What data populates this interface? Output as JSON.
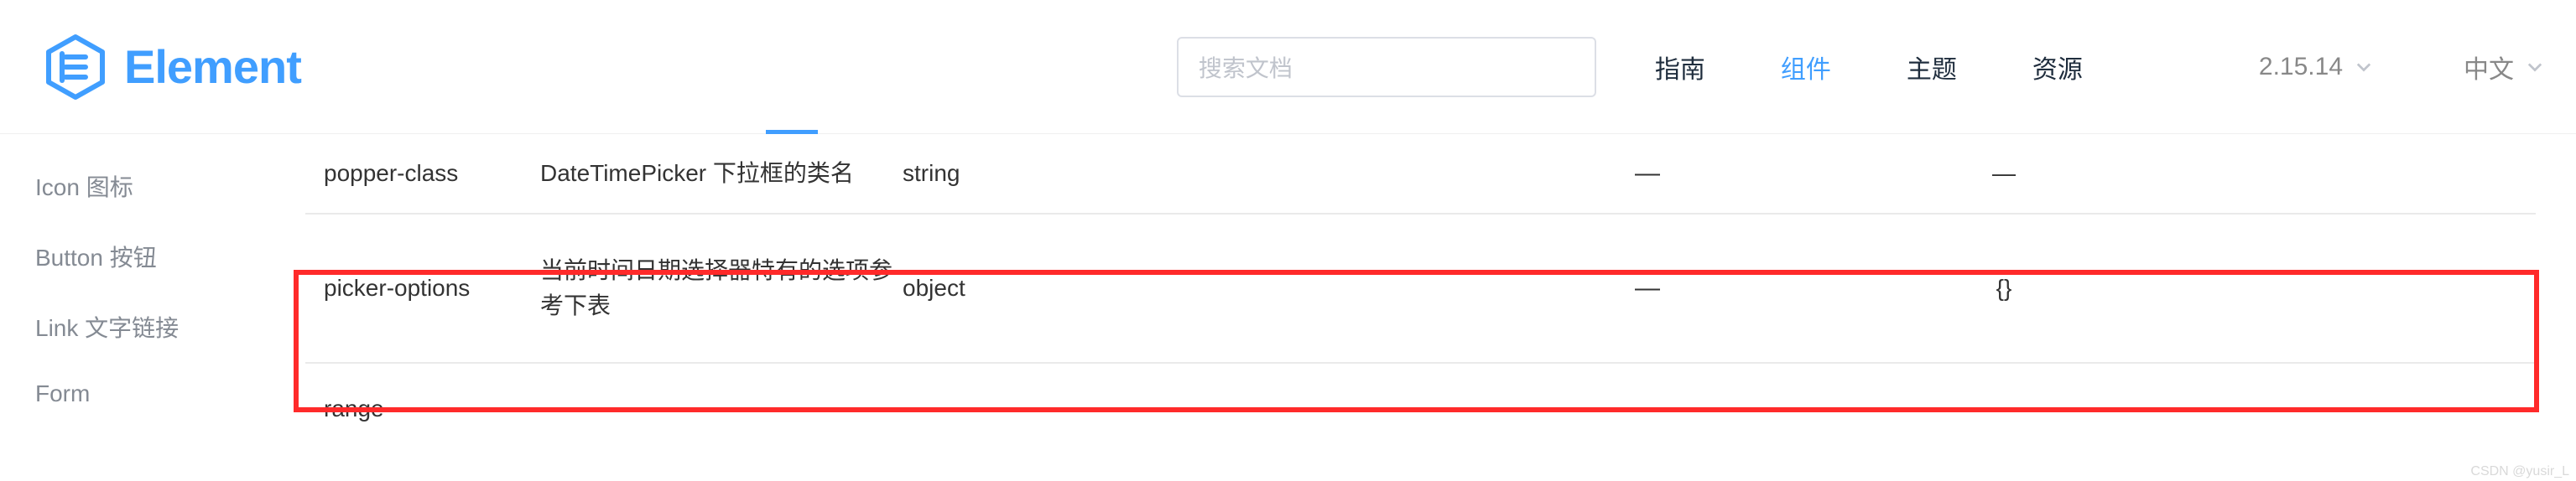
{
  "brand": {
    "name": "Element"
  },
  "search": {
    "placeholder": "搜索文档"
  },
  "nav": {
    "items": [
      "指南",
      "组件",
      "主题",
      "资源"
    ],
    "active_index": 1
  },
  "version": {
    "label": "2.15.14"
  },
  "lang": {
    "label": "中文"
  },
  "sidebar": {
    "items": [
      "Icon 图标",
      "Button 按钮",
      "Link 文字链接",
      "Form"
    ]
  },
  "table": {
    "rows": [
      {
        "param": "popper-class",
        "desc": "DateTimePicker 下拉框的类名",
        "type": "string",
        "options": "—",
        "default": "—"
      },
      {
        "param": "picker-options",
        "desc": "当前时间日期选择器特有的选项参考下表",
        "type": "object",
        "options": "—",
        "default": "{}"
      }
    ],
    "truncated_param": "range-"
  },
  "watermark": "CSDN @yusir_L"
}
